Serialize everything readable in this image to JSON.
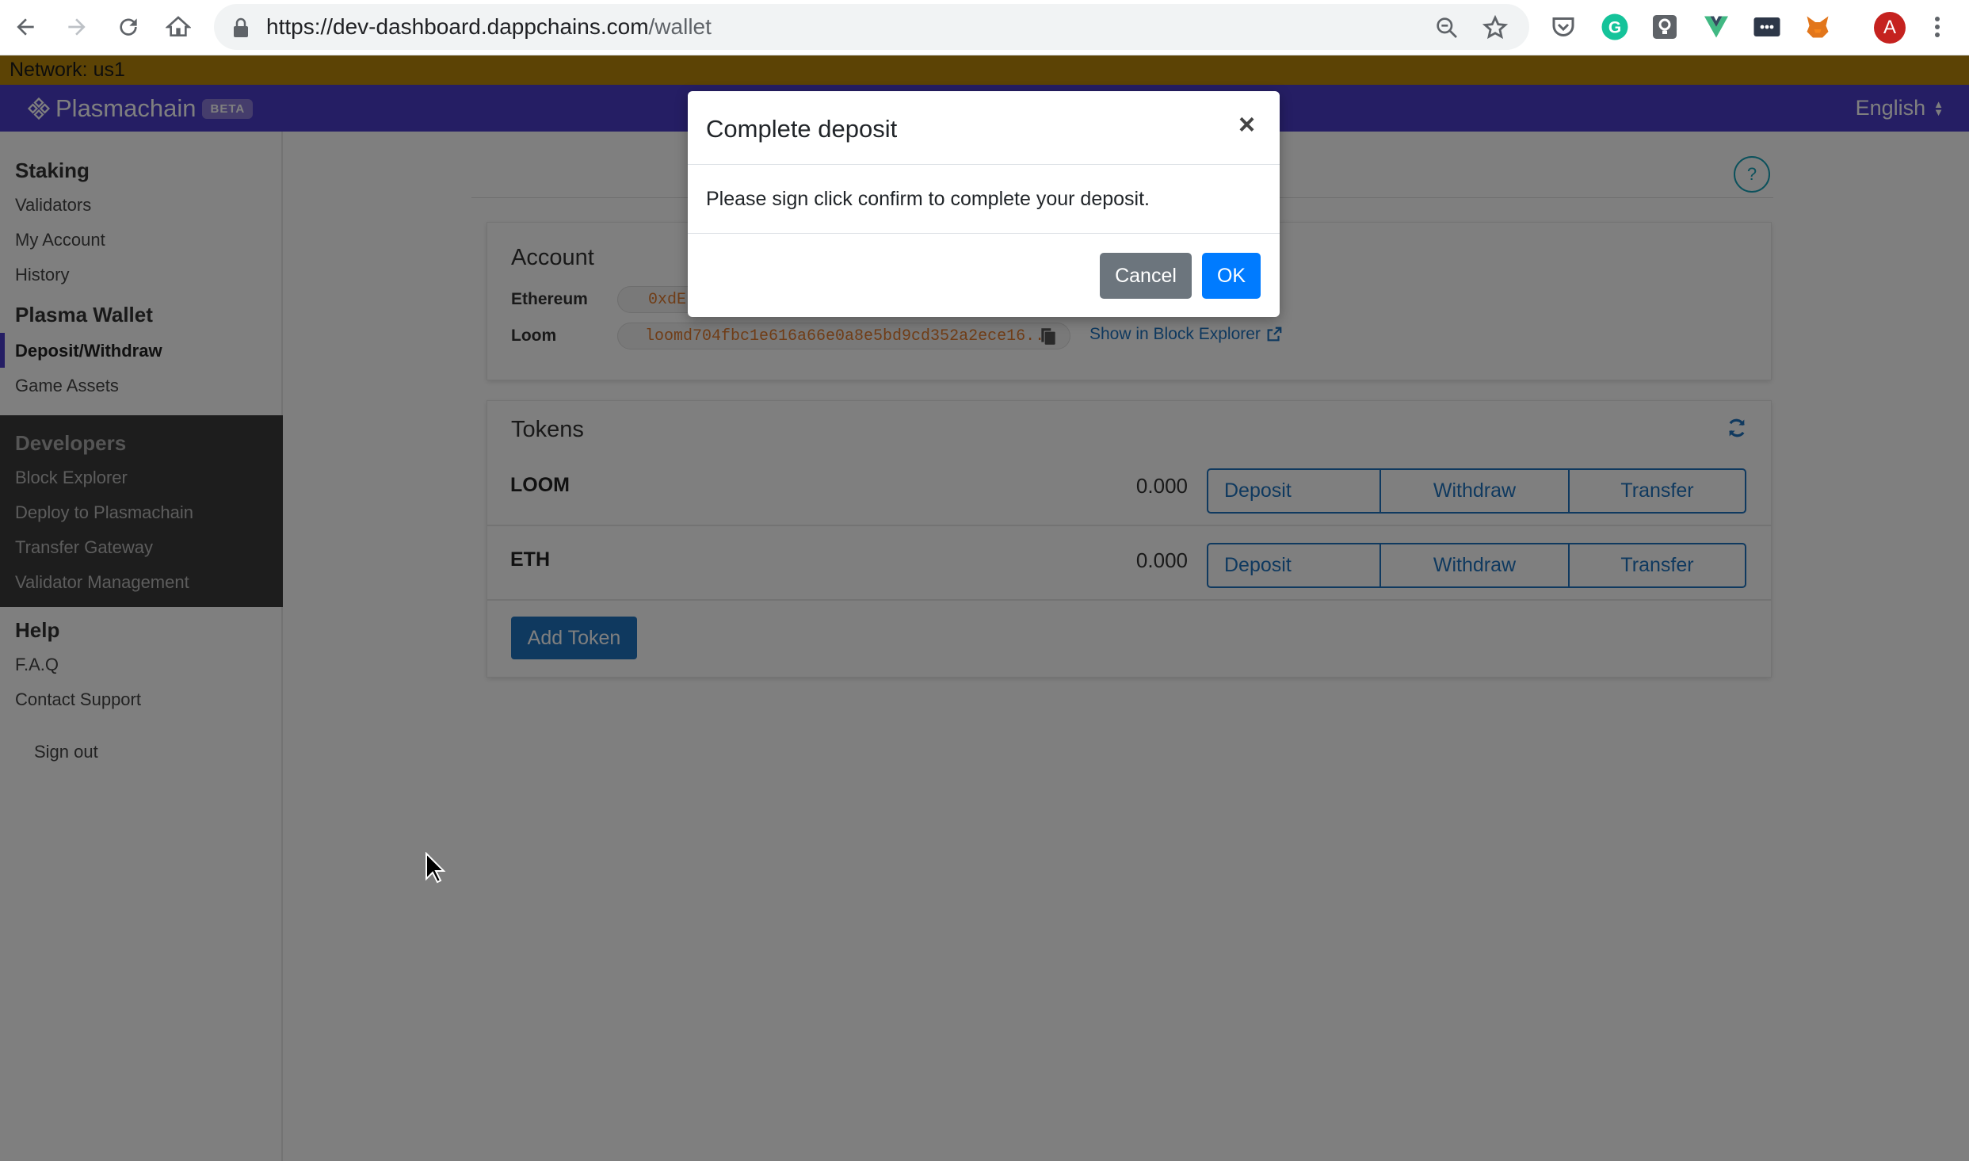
{
  "browser": {
    "url_host": "https://dev-dashboard.dappchains.com",
    "url_path": "/wallet",
    "profile_initial": "A"
  },
  "network": {
    "label": "Network: us1"
  },
  "header": {
    "brand": "Plasmachain",
    "badge": "BETA",
    "language": "English",
    "brand_color": "#4b3cc9"
  },
  "sidebar": {
    "staking": {
      "heading": "Staking",
      "items": [
        "Validators",
        "My Account",
        "History"
      ]
    },
    "wallet": {
      "heading": "Plasma Wallet",
      "items": [
        "Deposit/Withdraw",
        "Game Assets"
      ],
      "active": "Deposit/Withdraw"
    },
    "developers": {
      "heading": "Developers",
      "items": [
        "Block Explorer",
        "Deploy to Plasmachain",
        "Transfer Gateway",
        "Validator Management"
      ]
    },
    "help": {
      "heading": "Help",
      "items": [
        "F.A.Q",
        "Contact Support"
      ]
    },
    "signout": "Sign out"
  },
  "account": {
    "title": "Account",
    "ethereum_label": "Ethereum",
    "ethereum_address": "0xdE",
    "loom_label": "Loom",
    "loom_address": "loomd704fbc1e616a66e0a8e5bd9cd352a2ece16...",
    "explorer_link": "Show in Block Explorer"
  },
  "tokens": {
    "title": "Tokens",
    "rows": [
      {
        "symbol": "LOOM",
        "balance": "0.000",
        "deposit": "Deposit",
        "withdraw": "Withdraw",
        "transfer": "Transfer"
      },
      {
        "symbol": "ETH",
        "balance": "0.000",
        "deposit": "Deposit",
        "withdraw": "Withdraw",
        "transfer": "Transfer"
      }
    ],
    "add_button": "Add Token"
  },
  "modal": {
    "title": "Complete deposit",
    "close": "×",
    "body": "Please sign click confirm to complete your deposit.",
    "cancel": "Cancel",
    "ok": "OK"
  },
  "help_button": "?"
}
